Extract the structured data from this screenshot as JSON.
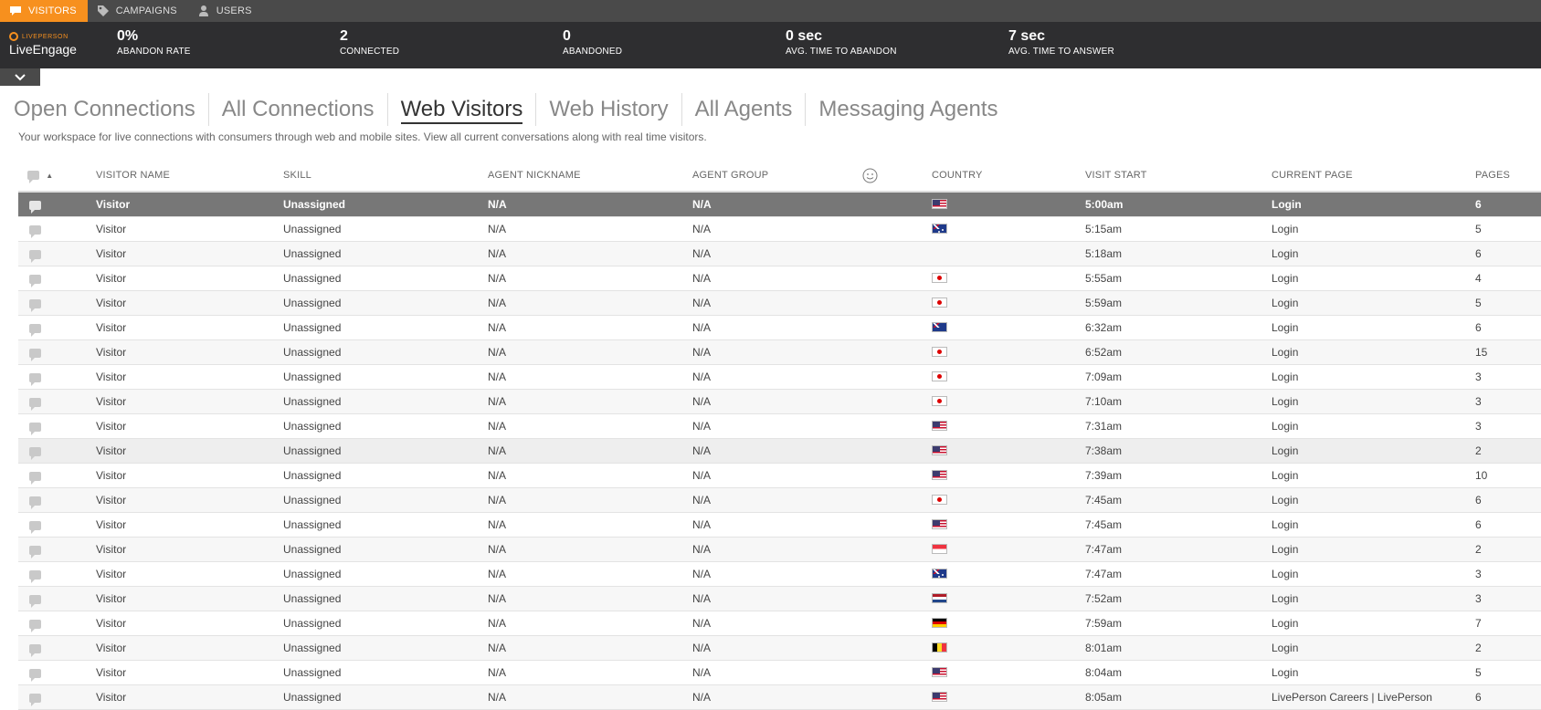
{
  "topnav": {
    "tabs": [
      {
        "label": "VISITORS",
        "icon": "chat-icon",
        "active": true
      },
      {
        "label": "CAMPAIGNS",
        "icon": "tag-icon",
        "active": false
      },
      {
        "label": "USERS",
        "icon": "user-icon",
        "active": false
      }
    ]
  },
  "brand": {
    "company": "LIVEPERSON",
    "product": "LiveEngage"
  },
  "stats": [
    {
      "value": "0%",
      "label": "ABANDON RATE"
    },
    {
      "value": "2",
      "label": "CONNECTED"
    },
    {
      "value": "0",
      "label": "ABANDONED"
    },
    {
      "value": "0 sec",
      "label": "AVG. TIME TO ABANDON"
    },
    {
      "value": "7 sec",
      "label": "AVG. TIME TO ANSWER"
    }
  ],
  "subtabs": [
    {
      "label": "Open Connections",
      "active": false
    },
    {
      "label": "All Connections",
      "active": false
    },
    {
      "label": "Web Visitors",
      "active": true
    },
    {
      "label": "Web History",
      "active": false
    },
    {
      "label": "All Agents",
      "active": false
    },
    {
      "label": "Messaging Agents",
      "active": false
    }
  ],
  "description": "Your workspace for live connections with consumers through web and mobile sites. View all current conversations along with real time visitors.",
  "table": {
    "columns": [
      "VISITOR NAME",
      "SKILL",
      "AGENT NICKNAME",
      "AGENT GROUP",
      "COUNTRY",
      "VISIT START",
      "CURRENT PAGE",
      "PAGES"
    ],
    "rows": [
      {
        "name": "Visitor",
        "skill": "Unassigned",
        "nickname": "N/A",
        "group": "N/A",
        "country": "us",
        "start": "5:00am",
        "page": "Login",
        "pages": "6"
      },
      {
        "name": "Visitor",
        "skill": "Unassigned",
        "nickname": "N/A",
        "group": "N/A",
        "country": "au",
        "start": "5:15am",
        "page": "Login",
        "pages": "5"
      },
      {
        "name": "Visitor",
        "skill": "Unassigned",
        "nickname": "N/A",
        "group": "N/A",
        "country": "",
        "start": "5:18am",
        "page": "Login",
        "pages": "6"
      },
      {
        "name": "Visitor",
        "skill": "Unassigned",
        "nickname": "N/A",
        "group": "N/A",
        "country": "jp",
        "start": "5:55am",
        "page": "Login",
        "pages": "4"
      },
      {
        "name": "Visitor",
        "skill": "Unassigned",
        "nickname": "N/A",
        "group": "N/A",
        "country": "jp",
        "start": "5:59am",
        "page": "Login",
        "pages": "5"
      },
      {
        "name": "Visitor",
        "skill": "Unassigned",
        "nickname": "N/A",
        "group": "N/A",
        "country": "nz",
        "start": "6:32am",
        "page": "Login",
        "pages": "6"
      },
      {
        "name": "Visitor",
        "skill": "Unassigned",
        "nickname": "N/A",
        "group": "N/A",
        "country": "jp",
        "start": "6:52am",
        "page": "Login",
        "pages": "15"
      },
      {
        "name": "Visitor",
        "skill": "Unassigned",
        "nickname": "N/A",
        "group": "N/A",
        "country": "jp",
        "start": "7:09am",
        "page": "Login",
        "pages": "3"
      },
      {
        "name": "Visitor",
        "skill": "Unassigned",
        "nickname": "N/A",
        "group": "N/A",
        "country": "jp",
        "start": "7:10am",
        "page": "Login",
        "pages": "3"
      },
      {
        "name": "Visitor",
        "skill": "Unassigned",
        "nickname": "N/A",
        "group": "N/A",
        "country": "us",
        "start": "7:31am",
        "page": "Login",
        "pages": "3"
      },
      {
        "name": "Visitor",
        "skill": "Unassigned",
        "nickname": "N/A",
        "group": "N/A",
        "country": "us",
        "start": "7:38am",
        "page": "Login",
        "pages": "2"
      },
      {
        "name": "Visitor",
        "skill": "Unassigned",
        "nickname": "N/A",
        "group": "N/A",
        "country": "us",
        "start": "7:39am",
        "page": "Login",
        "pages": "10"
      },
      {
        "name": "Visitor",
        "skill": "Unassigned",
        "nickname": "N/A",
        "group": "N/A",
        "country": "jp",
        "start": "7:45am",
        "page": "Login",
        "pages": "6"
      },
      {
        "name": "Visitor",
        "skill": "Unassigned",
        "nickname": "N/A",
        "group": "N/A",
        "country": "us",
        "start": "7:45am",
        "page": "Login",
        "pages": "6"
      },
      {
        "name": "Visitor",
        "skill": "Unassigned",
        "nickname": "N/A",
        "group": "N/A",
        "country": "sg",
        "start": "7:47am",
        "page": "Login",
        "pages": "2"
      },
      {
        "name": "Visitor",
        "skill": "Unassigned",
        "nickname": "N/A",
        "group": "N/A",
        "country": "au",
        "start": "7:47am",
        "page": "Login",
        "pages": "3"
      },
      {
        "name": "Visitor",
        "skill": "Unassigned",
        "nickname": "N/A",
        "group": "N/A",
        "country": "nl",
        "start": "7:52am",
        "page": "Login",
        "pages": "3"
      },
      {
        "name": "Visitor",
        "skill": "Unassigned",
        "nickname": "N/A",
        "group": "N/A",
        "country": "de",
        "start": "7:59am",
        "page": "Login",
        "pages": "7"
      },
      {
        "name": "Visitor",
        "skill": "Unassigned",
        "nickname": "N/A",
        "group": "N/A",
        "country": "be",
        "start": "8:01am",
        "page": "Login",
        "pages": "2"
      },
      {
        "name": "Visitor",
        "skill": "Unassigned",
        "nickname": "N/A",
        "group": "N/A",
        "country": "us",
        "start": "8:04am",
        "page": "Login",
        "pages": "5"
      },
      {
        "name": "Visitor",
        "skill": "Unassigned",
        "nickname": "N/A",
        "group": "N/A",
        "country": "us",
        "start": "8:05am",
        "page": "LivePerson Careers | LivePerson",
        "pages": "6"
      }
    ]
  },
  "colors": {
    "accent": "#f7901e",
    "statsbar": "#2e2e30",
    "selected_row": "#777777"
  }
}
